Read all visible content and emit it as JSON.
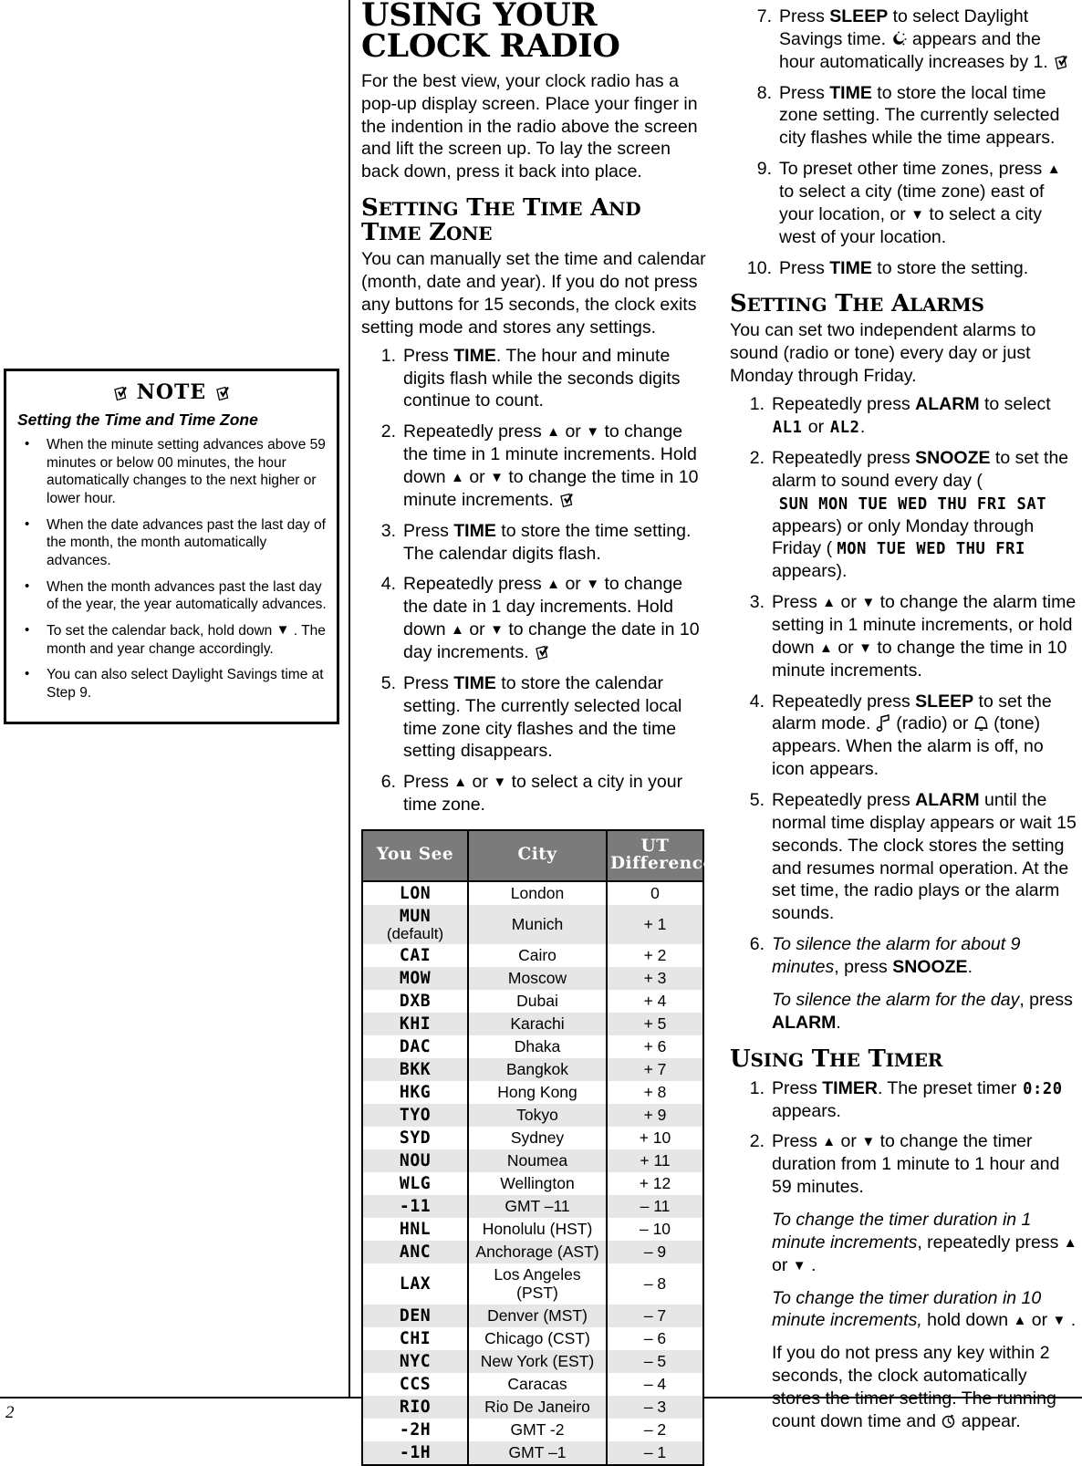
{
  "page": {
    "number": "2"
  },
  "note_box": {
    "title": "NOTE",
    "subtitle": "Setting the Time and Time Zone",
    "bullets": [
      "When the minute setting advances above 59 minutes or below 00 minutes, the hour automatically changes to the next higher or lower hour.",
      "When the date advances past the last day of the month, the month automatically advances.",
      "When the month advances past the last day of the year, the year automatically advances.",
      "To set the calendar back, hold down ▼ . The month and year change accordingly.",
      "You can also select Daylight Savings time at Step 9."
    ]
  },
  "chapter": {
    "title": "USING YOUR CLOCK RADIO",
    "intro": "For the best view, your clock radio has a pop-up display screen. Place your finger in the indention in the radio above the screen and lift the screen up. To lay the screen back down, press it back into place."
  },
  "section_time": {
    "heading_part1": "S",
    "heading": "SETTING THE TIME AND TIME ZONE",
    "intro": "You can manually set the time and calendar (month, date and year). If you do not press any buttons for 15 seconds, the clock exits setting mode and stores any settings.",
    "steps": [
      {
        "num": "1.",
        "text_html": "Press <b>TIME</b>. The hour and minute digits flash while the seconds digits continue to count."
      },
      {
        "num": "2.",
        "text_html": "Repeatedly press ▲ or ▼ to change the time in 1 minute increments. Hold down ▲ or ▼ to change the time in 10 minute increments. [NOTEICON]"
      },
      {
        "num": "3.",
        "text_html": "Press <b>TIME</b> to store the time setting. The calendar digits flash."
      },
      {
        "num": "4.",
        "text_html": "Repeatedly press ▲ or ▼ to change the date in 1 day increments. Hold down ▲ or ▼ to change the date in 10 day increments. [NOTEICON]"
      },
      {
        "num": "5.",
        "text_html": "Press <b>TIME</b> to store the calendar setting. The currently selected local time zone city flashes and the time setting disappears."
      },
      {
        "num": "6.",
        "text_html": "Press ▲ or ▼ to select a city in your time zone."
      },
      {
        "num": "7.",
        "text_html": "Press <b>SLEEP</b> to select Daylight Savings time. [SUNICON] appears and the hour automatically increases by 1. [NOTEICON]"
      },
      {
        "num": "8.",
        "text_html": "Press <b>TIME</b> to store the local time zone setting. The currently selected city flashes while the time appears."
      },
      {
        "num": "9.",
        "text_html": "To preset other time zones, press ▲ to select a city (time zone) east of your location, or ▼ to select a city west of your location."
      },
      {
        "num": "10.",
        "text_html": "Press <b>TIME</b> to store the setting."
      }
    ]
  },
  "timezone_table": {
    "columns": [
      "You See",
      "UT",
      "Difference",
      "City"
    ],
    "header": {
      "you_see": "You See",
      "city": "City",
      "ut": "UT",
      "difference": "Difference"
    },
    "rows": [
      {
        "code": "LON",
        "city": "London",
        "diff": "0",
        "note": ""
      },
      {
        "code": "MUN",
        "city": "Munich",
        "diff": "+ 1",
        "note": "(default)"
      },
      {
        "code": "CAI",
        "city": "Cairo",
        "diff": "+ 2",
        "note": ""
      },
      {
        "code": "MOW",
        "city": "Moscow",
        "diff": "+ 3",
        "note": ""
      },
      {
        "code": "DXB",
        "city": "Dubai",
        "diff": "+ 4",
        "note": ""
      },
      {
        "code": "KHI",
        "city": "Karachi",
        "diff": "+ 5",
        "note": ""
      },
      {
        "code": "DAC",
        "city": "Dhaka",
        "diff": "+ 6",
        "note": ""
      },
      {
        "code": "BKK",
        "city": "Bangkok",
        "diff": "+ 7",
        "note": ""
      },
      {
        "code": "HKG",
        "city": "Hong Kong",
        "diff": "+ 8",
        "note": ""
      },
      {
        "code": "TYO",
        "city": "Tokyo",
        "diff": "+ 9",
        "note": ""
      },
      {
        "code": "SYD",
        "city": "Sydney",
        "diff": "+ 10",
        "note": ""
      },
      {
        "code": "NOU",
        "city": "Noumea",
        "diff": "+ 11",
        "note": ""
      },
      {
        "code": "WLG",
        "city": "Wellington",
        "diff": "+ 12",
        "note": ""
      },
      {
        "code": "-11",
        "city": "GMT –11",
        "diff": "– 11",
        "note": ""
      },
      {
        "code": "HNL",
        "city": "Honolulu (HST)",
        "diff": "– 10",
        "note": ""
      },
      {
        "code": "ANC",
        "city": "Anchorage (AST)",
        "diff": "– 9",
        "note": ""
      },
      {
        "code": "LAX",
        "city": "Los Angeles (PST)",
        "diff": "– 8",
        "note": ""
      },
      {
        "code": "DEN",
        "city": "Denver (MST)",
        "diff": "– 7",
        "note": ""
      },
      {
        "code": "CHI",
        "city": "Chicago (CST)",
        "diff": "– 6",
        "note": ""
      },
      {
        "code": "NYC",
        "city": "New York (EST)",
        "diff": "– 5",
        "note": ""
      },
      {
        "code": "CCS",
        "city": "Caracas",
        "diff": "– 4",
        "note": ""
      },
      {
        "code": "RIO",
        "city": "Rio De Janeiro",
        "diff": "– 3",
        "note": ""
      },
      {
        "code": "-2H",
        "city": "GMT -2",
        "diff": "– 2",
        "note": ""
      },
      {
        "code": "-1H",
        "city": "GMT –1",
        "diff": "– 1",
        "note": ""
      }
    ]
  },
  "section_alarms": {
    "heading": "SETTING THE ALARMS",
    "intro": "You can set two independent alarms to sound (radio or tone) every day or just Monday through Friday.",
    "steps": [
      {
        "num": "1.",
        "text_html": "Repeatedly press <b>ALARM</b> to select <span class=\"lcd\">AL1</span> or <span class=\"lcd\">AL2</span>."
      },
      {
        "num": "2.",
        "text_html": "Repeatedly press <b>SNOOZE</b> to set the alarm to sound every day (<span class=\"lcd\">SUN MON TUE WED THU FRI SAT</span> appears) or only Monday through Friday (<span class=\"lcd\">MON TUE WED THU FRI</span> appears)."
      },
      {
        "num": "3.",
        "text_html": "Press ▲ or ▼ to change the alarm time setting in 1 minute increments, or hold down ▲ or ▼ to change the time in 10 minute increments."
      },
      {
        "num": "4.",
        "text_html": "Repeatedly press <b>SLEEP</b> to set the alarm mode. [MUSICICON] (radio) or [BELLICON] (tone) appears. When the alarm is off, no icon appears."
      },
      {
        "num": "5.",
        "text_html": "Repeatedly press <b>ALARM</b> until the normal time display appears or wait 15 seconds. The clock stores the setting and resumes normal operation. At the set time, the radio plays or the alarm sounds."
      },
      {
        "num": "6.",
        "text_html": "<i>To silence the alarm for about 9 minutes</i>, press <b>SNOOZE</b>.[BREAK]<i>To silence the alarm for the day</i>, press <b>ALARM</b>."
      }
    ]
  },
  "section_timer": {
    "heading": "USING THE TIMER",
    "steps": [
      {
        "num": "1.",
        "text_html": "Press <b>TIMER</b>. The preset timer <span class=\"lcd\">0:20</span> appears."
      },
      {
        "num": "2.",
        "text_html": "Press ▲ or ▼ to change the timer duration from 1 minute to 1 hour and 59 minutes.[BREAK]<i>To change the timer duration in 1 minute increments</i>, repeatedly press ▲ or ▼ .[BREAK]<i>To change the timer duration in 10 minute increments,</i> hold down ▲ or ▼ .[BREAK]If you do not press any key within 2 seconds, the clock automatically stores the timer setting. The running count down time and [TIMERICON] appear."
      }
    ]
  },
  "icons": {
    "note": "note-pencil-icon",
    "sun": "sun-daylight-savings-icon",
    "music": "music-note-radio-icon",
    "bell": "bell-tone-icon",
    "timer": "timer-clock-icon",
    "up_arrow": "▲",
    "down_arrow": "▼"
  },
  "colors": {
    "table_header_bg": "#7b7b7b",
    "table_alt_row_bg": "#e6e6e6",
    "rule": "#000000"
  }
}
